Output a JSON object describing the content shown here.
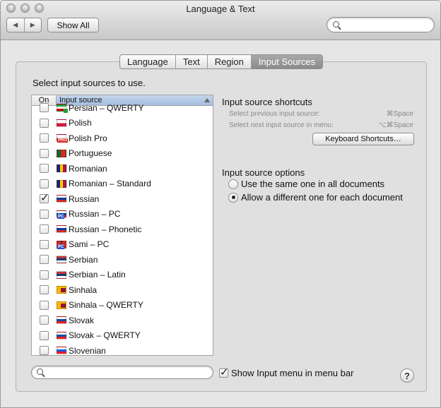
{
  "window": {
    "title": "Language & Text"
  },
  "toolbar": {
    "back_icon": "◀",
    "forward_icon": "▶",
    "show_all": "Show All",
    "search_placeholder": ""
  },
  "tabs": [
    {
      "label": "Language",
      "active": false
    },
    {
      "label": "Text",
      "active": false
    },
    {
      "label": "Region",
      "active": false
    },
    {
      "label": "Input Sources",
      "active": true
    }
  ],
  "instruction": "Select input sources to use.",
  "table": {
    "headers": {
      "on": "On",
      "source": "Input source"
    },
    "rows": [
      {
        "label": "Persian – QWERTY",
        "checked": false,
        "flag": "persian"
      },
      {
        "label": "Polish",
        "checked": false,
        "flag": "polish"
      },
      {
        "label": "Polish Pro",
        "checked": false,
        "flag": "polish-pro"
      },
      {
        "label": "Portuguese",
        "checked": false,
        "flag": "portuguese"
      },
      {
        "label": "Romanian",
        "checked": false,
        "flag": "romanian"
      },
      {
        "label": "Romanian – Standard",
        "checked": false,
        "flag": "romanian"
      },
      {
        "label": "Russian",
        "checked": true,
        "flag": "russian"
      },
      {
        "label": "Russian – PC",
        "checked": false,
        "flag": "russian"
      },
      {
        "label": "Russian – Phonetic",
        "checked": false,
        "flag": "russian"
      },
      {
        "label": "Sami – PC",
        "checked": false,
        "flag": "sami"
      },
      {
        "label": "Serbian",
        "checked": false,
        "flag": "serbian"
      },
      {
        "label": "Serbian – Latin",
        "checked": false,
        "flag": "serbian"
      },
      {
        "label": "Sinhala",
        "checked": false,
        "flag": "sinhala"
      },
      {
        "label": "Sinhala – QWERTY",
        "checked": false,
        "flag": "sinhala"
      },
      {
        "label": "Slovak",
        "checked": false,
        "flag": "slovak"
      },
      {
        "label": "Slovak – QWERTY",
        "checked": false,
        "flag": "slovak"
      },
      {
        "label": "Slovenian",
        "checked": false,
        "flag": "slovenian"
      }
    ]
  },
  "shortcuts": {
    "heading": "Input source shortcuts",
    "prev_label": "Select previous input source:",
    "prev_key": "⌘Space",
    "next_label": "Select next input source in menu:",
    "next_key": "⌥⌘Space",
    "keyboard_button": "Keyboard Shortcuts…"
  },
  "options": {
    "heading": "Input source options",
    "same": "Use the same one in all documents",
    "different": "Allow a different one for each document",
    "selected": "different"
  },
  "bottom": {
    "show_menu_label": "Show Input menu in menu bar",
    "show_menu_checked": true,
    "help": "?"
  }
}
